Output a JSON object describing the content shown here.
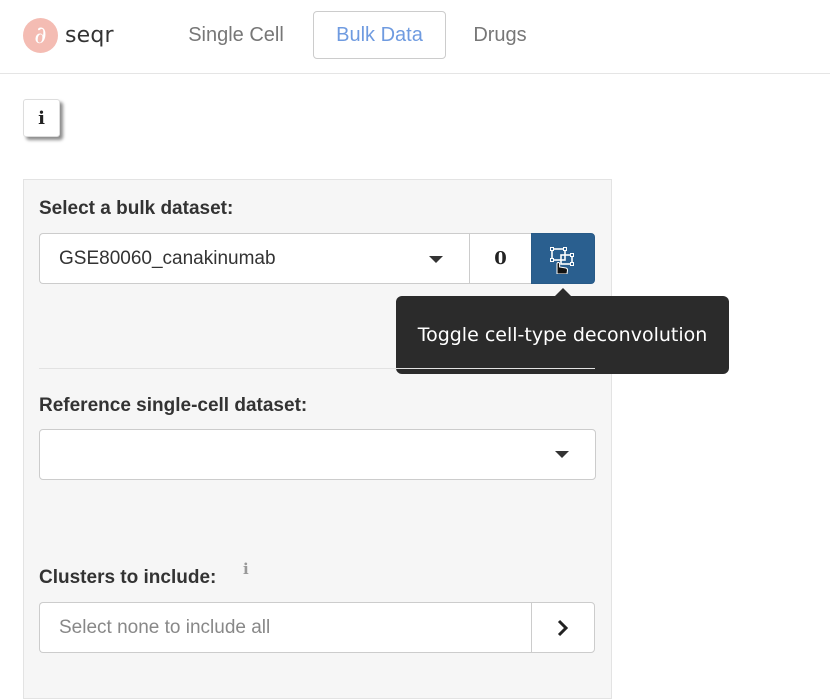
{
  "navbar": {
    "brand": {
      "logo_glyph": "∂",
      "name": "seqr",
      "logo_color": "#f4bcb3"
    },
    "tabs": [
      {
        "label": "Single Cell",
        "active": false
      },
      {
        "label": "Bulk Data",
        "active": true
      },
      {
        "label": "Drugs",
        "active": false
      }
    ],
    "active_tab_color": "#6f9be0"
  },
  "info_button": {
    "glyph": "i",
    "icon": "info-icon"
  },
  "panel": {
    "bulk_dataset": {
      "label": "Select a bulk dataset:",
      "value": "GSE80060_canakinumab",
      "count": "0",
      "deconvolution_button": {
        "icon": "deconvolution-icon",
        "color": "#2a5f8f"
      }
    },
    "reference_dataset": {
      "label": "Reference single-cell dataset:",
      "value": ""
    },
    "clusters": {
      "label": "Clusters to include:",
      "info_glyph": "i",
      "placeholder": "Select none to include all",
      "button_icon": "chevron-right-icon"
    }
  },
  "tooltip": {
    "text": "Toggle cell-type deconvolution"
  }
}
